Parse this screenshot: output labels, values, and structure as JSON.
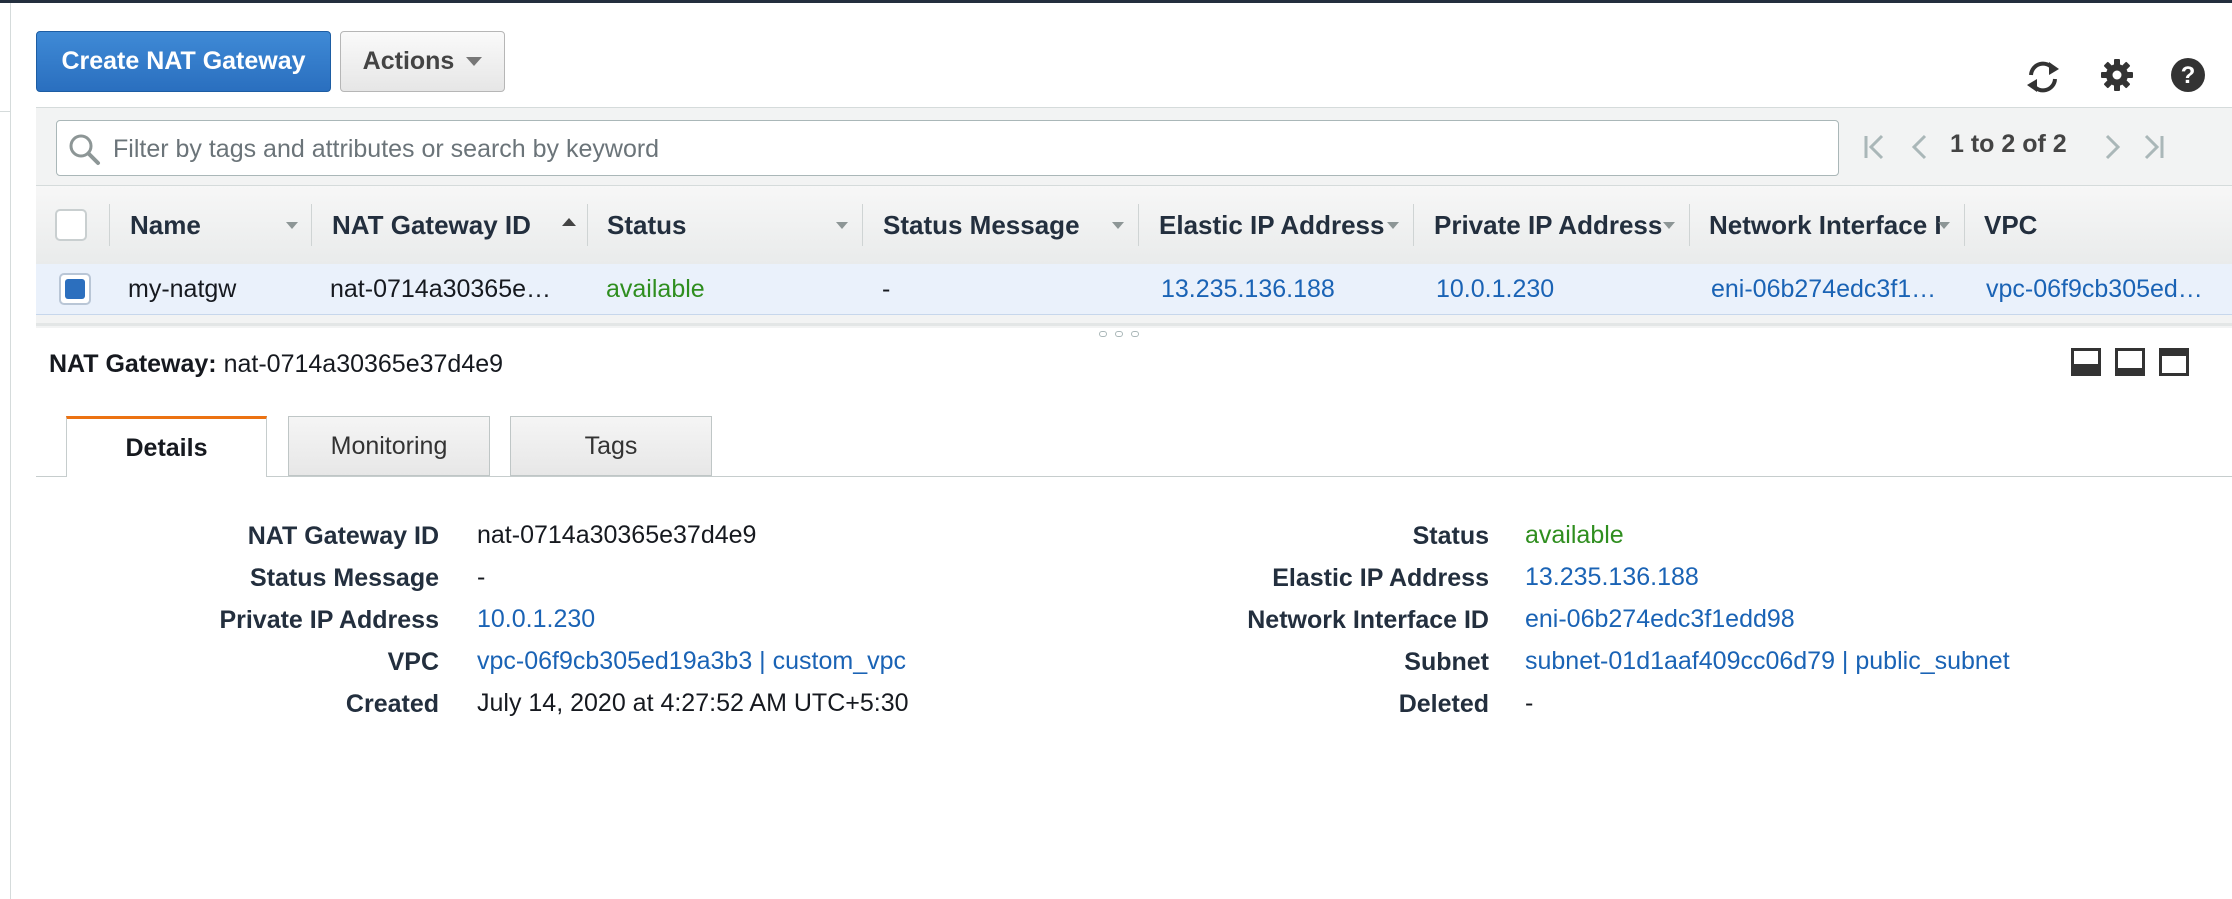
{
  "toolbar": {
    "create_label": "Create NAT Gateway",
    "actions_label": "Actions",
    "icons": [
      "refresh-icon",
      "gear-icon",
      "help-icon"
    ]
  },
  "search": {
    "placeholder": "Filter by tags and attributes or search by keyword",
    "value": ""
  },
  "pagination": {
    "range_text": "1 to 2 of 2"
  },
  "table": {
    "columns": [
      "Name",
      "NAT Gateway ID",
      "Status",
      "Status Message",
      "Elastic IP Address",
      "Private IP Address",
      "Network Interface I",
      "VPC"
    ],
    "sorted_column": "NAT Gateway ID",
    "rows": [
      {
        "selected": true,
        "name": "my-natgw",
        "nat_gateway_id": "nat-0714a30365e…",
        "status": "available",
        "status_message": "-",
        "elastic_ip": "13.235.136.188",
        "private_ip": "10.0.1.230",
        "network_interface": "eni-06b274edc3f1…",
        "vpc": "vpc-06f9cb305ed…"
      }
    ]
  },
  "details": {
    "title_label": "NAT Gateway:",
    "title_value": "nat-0714a30365e37d4e9",
    "tabs": [
      {
        "label": "Details",
        "active": true
      },
      {
        "label": "Monitoring",
        "active": false
      },
      {
        "label": "Tags",
        "active": false
      }
    ],
    "left": [
      {
        "label": "NAT Gateway ID",
        "value": "nat-0714a30365e37d4e9"
      },
      {
        "label": "Status Message",
        "value": "-"
      },
      {
        "label": "Private IP Address",
        "value": "10.0.1.230"
      },
      {
        "label": "VPC",
        "value": "vpc-06f9cb305ed19a3b3 | custom_vpc"
      },
      {
        "label": "Created",
        "value": "July 14, 2020 at 4:27:52 AM UTC+5:30"
      }
    ],
    "right": [
      {
        "label": "Status",
        "value": "available"
      },
      {
        "label": "Elastic IP Address",
        "value": "13.235.136.188"
      },
      {
        "label": "Network Interface ID",
        "value": "eni-06b274edc3f1edd98"
      },
      {
        "label": "Subnet",
        "value": "subnet-01d1aaf409cc06d79 | public_subnet"
      },
      {
        "label": "Deleted",
        "value": "-"
      }
    ]
  },
  "colors": {
    "primary_button": "#2a6fbf",
    "link": "#1a63b5",
    "status_ok": "#2f8e1f",
    "active_tab_accent": "#ec7211",
    "selected_row": "#eaf1fb"
  }
}
